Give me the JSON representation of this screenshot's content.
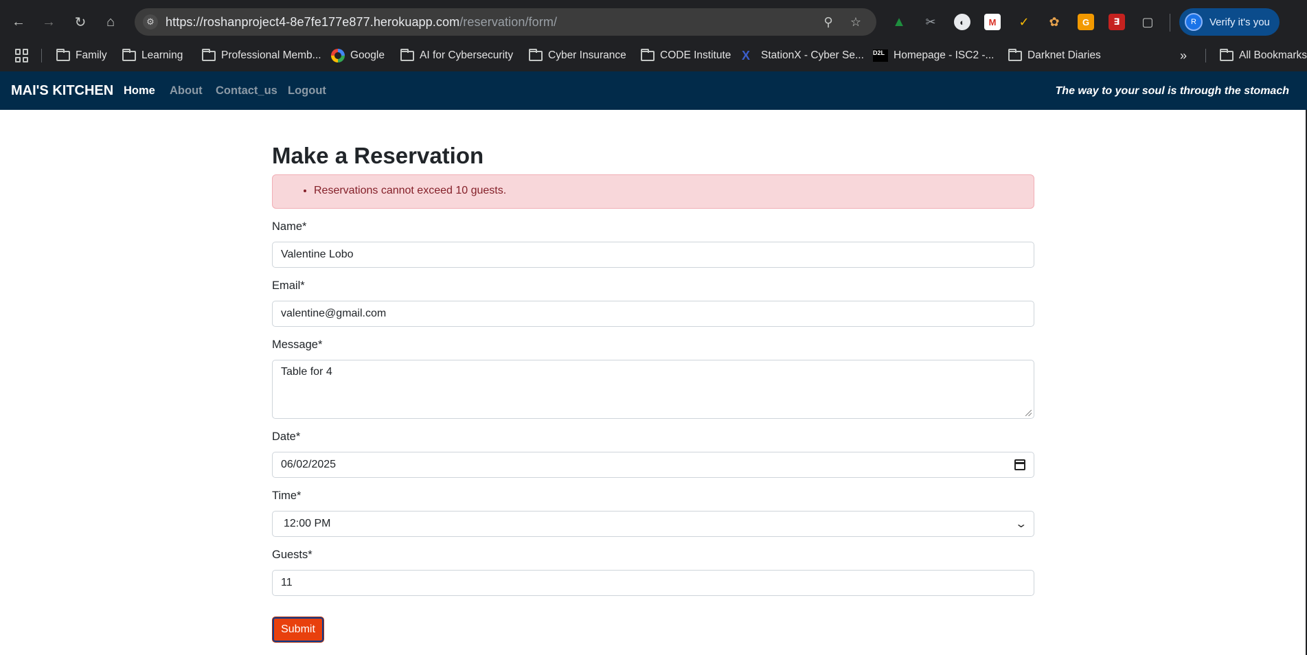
{
  "browser": {
    "url_host": "https://roshanproject4-8e7fe177e877.herokuapp.com",
    "url_path": "/reservation/form/",
    "profile_button": "Verify it's you",
    "profile_initial": "R",
    "bookmarks": [
      {
        "label": "Family",
        "icon": "folder-icon"
      },
      {
        "label": "Learning",
        "icon": "folder-icon"
      },
      {
        "label": "Professional Memb...",
        "icon": "folder-icon"
      },
      {
        "label": "Google",
        "icon": "google-icon"
      },
      {
        "label": "AI for Cybersecurity",
        "icon": "folder-icon"
      },
      {
        "label": "Cyber Insurance",
        "icon": "folder-icon"
      },
      {
        "label": "CODE Institute",
        "icon": "folder-icon"
      },
      {
        "label": "StationX - Cyber Se...",
        "icon": "stationx-icon"
      },
      {
        "label": "Homepage - ISC2 -...",
        "icon": "d2l-icon"
      },
      {
        "label": "Darknet Diaries",
        "icon": "folder-icon"
      }
    ],
    "all_bookmarks": "All Bookmarks",
    "d2l_badge": "D2L"
  },
  "site": {
    "brand": "MAI'S KITCHEN",
    "nav": [
      "Home",
      "About",
      "Contact_us",
      "Logout"
    ],
    "tagline": "The way to your soul is through the stomach"
  },
  "form": {
    "title": "Make a Reservation",
    "error": "Reservations cannot exceed 10 guests.",
    "name_label": "Name*",
    "name_value": "Valentine Lobo",
    "email_label": "Email*",
    "email_value": "valentine@gmail.com",
    "message_label": "Message*",
    "message_value": "Table for 4",
    "date_label": "Date*",
    "date_value": "06/02/2025",
    "time_label": "Time*",
    "time_value": "12:00 PM",
    "guests_label": "Guests*",
    "guests_value": "11",
    "submit_label": "Submit"
  }
}
